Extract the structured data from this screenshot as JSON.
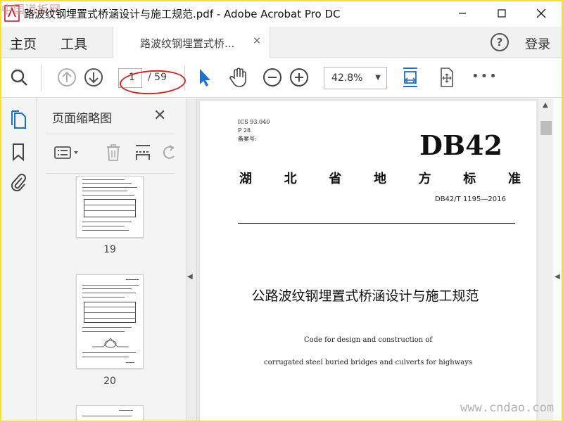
{
  "window": {
    "title": "路波纹钢埋置式桥涵设计与施工规范.pdf - Adobe Acrobat Pro DC",
    "watermark_top": "中国道板网",
    "minimize": "—",
    "maximize": "☐",
    "close": "✕"
  },
  "tabbar": {
    "home": "主页",
    "tools": "工具",
    "doc_tab": "路波纹钢埋置式桥...",
    "doc_tab_close": "×",
    "help": "?",
    "login": "登录"
  },
  "toolbar": {
    "page_current": "1",
    "page_total": "/ 59",
    "zoom": "42.8%",
    "more": "•••"
  },
  "thumbnail_panel": {
    "title": "页面缩略图",
    "close": "✕",
    "pages": [
      "19",
      "20"
    ]
  },
  "document": {
    "ics_lines": [
      "ICS 93.040",
      "P 28",
      "备案号:"
    ],
    "code": "DB42",
    "province_chars": [
      "湖",
      "北",
      "省",
      "地",
      "方",
      "标",
      "准"
    ],
    "standard_number": "DB42/T 1195—2016",
    "title": "公路波纹钢埋置式桥涵设计与施工规范",
    "english_line1": "Code for design and construction of",
    "english_line2": "corrugated steel buried bridges and culverts for highways"
  },
  "watermark_bottom": "www.cndao.com",
  "colors": {
    "accent_blue": "#1e6fcf",
    "annotation_red": "#d8251d",
    "frame_yellow": "#f4e03c"
  }
}
